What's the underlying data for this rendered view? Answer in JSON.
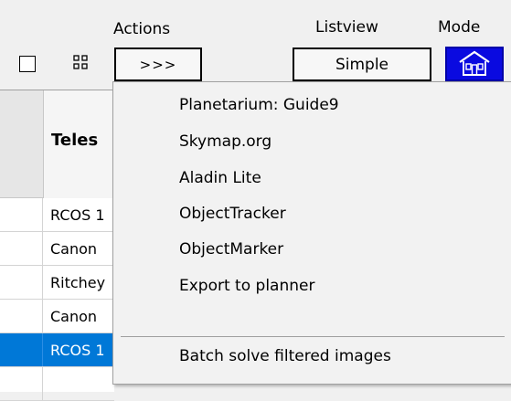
{
  "toolbar": {
    "actions_label": "Actions",
    "actions_button_label": ">>>",
    "listview_label": "Listview",
    "listview_value": "Simple",
    "mode_label": "Mode"
  },
  "table": {
    "header": "Teles",
    "rows": [
      "RCOS 1",
      "Canon",
      "Ritchey",
      "Canon",
      "RCOS 1"
    ],
    "selected_row_index": 4
  },
  "menu": {
    "items": [
      "Planetarium: Guide9",
      "Skymap.org",
      "Aladin Lite",
      "ObjectTracker",
      "ObjectMarker",
      "Export to planner",
      "Batch solve filtered images"
    ]
  },
  "colors": {
    "selection": "#0078d7",
    "mode_button": "#0a0ae0"
  },
  "icons": [
    "checkbox-icon",
    "grid-icon",
    "house-icon"
  ]
}
